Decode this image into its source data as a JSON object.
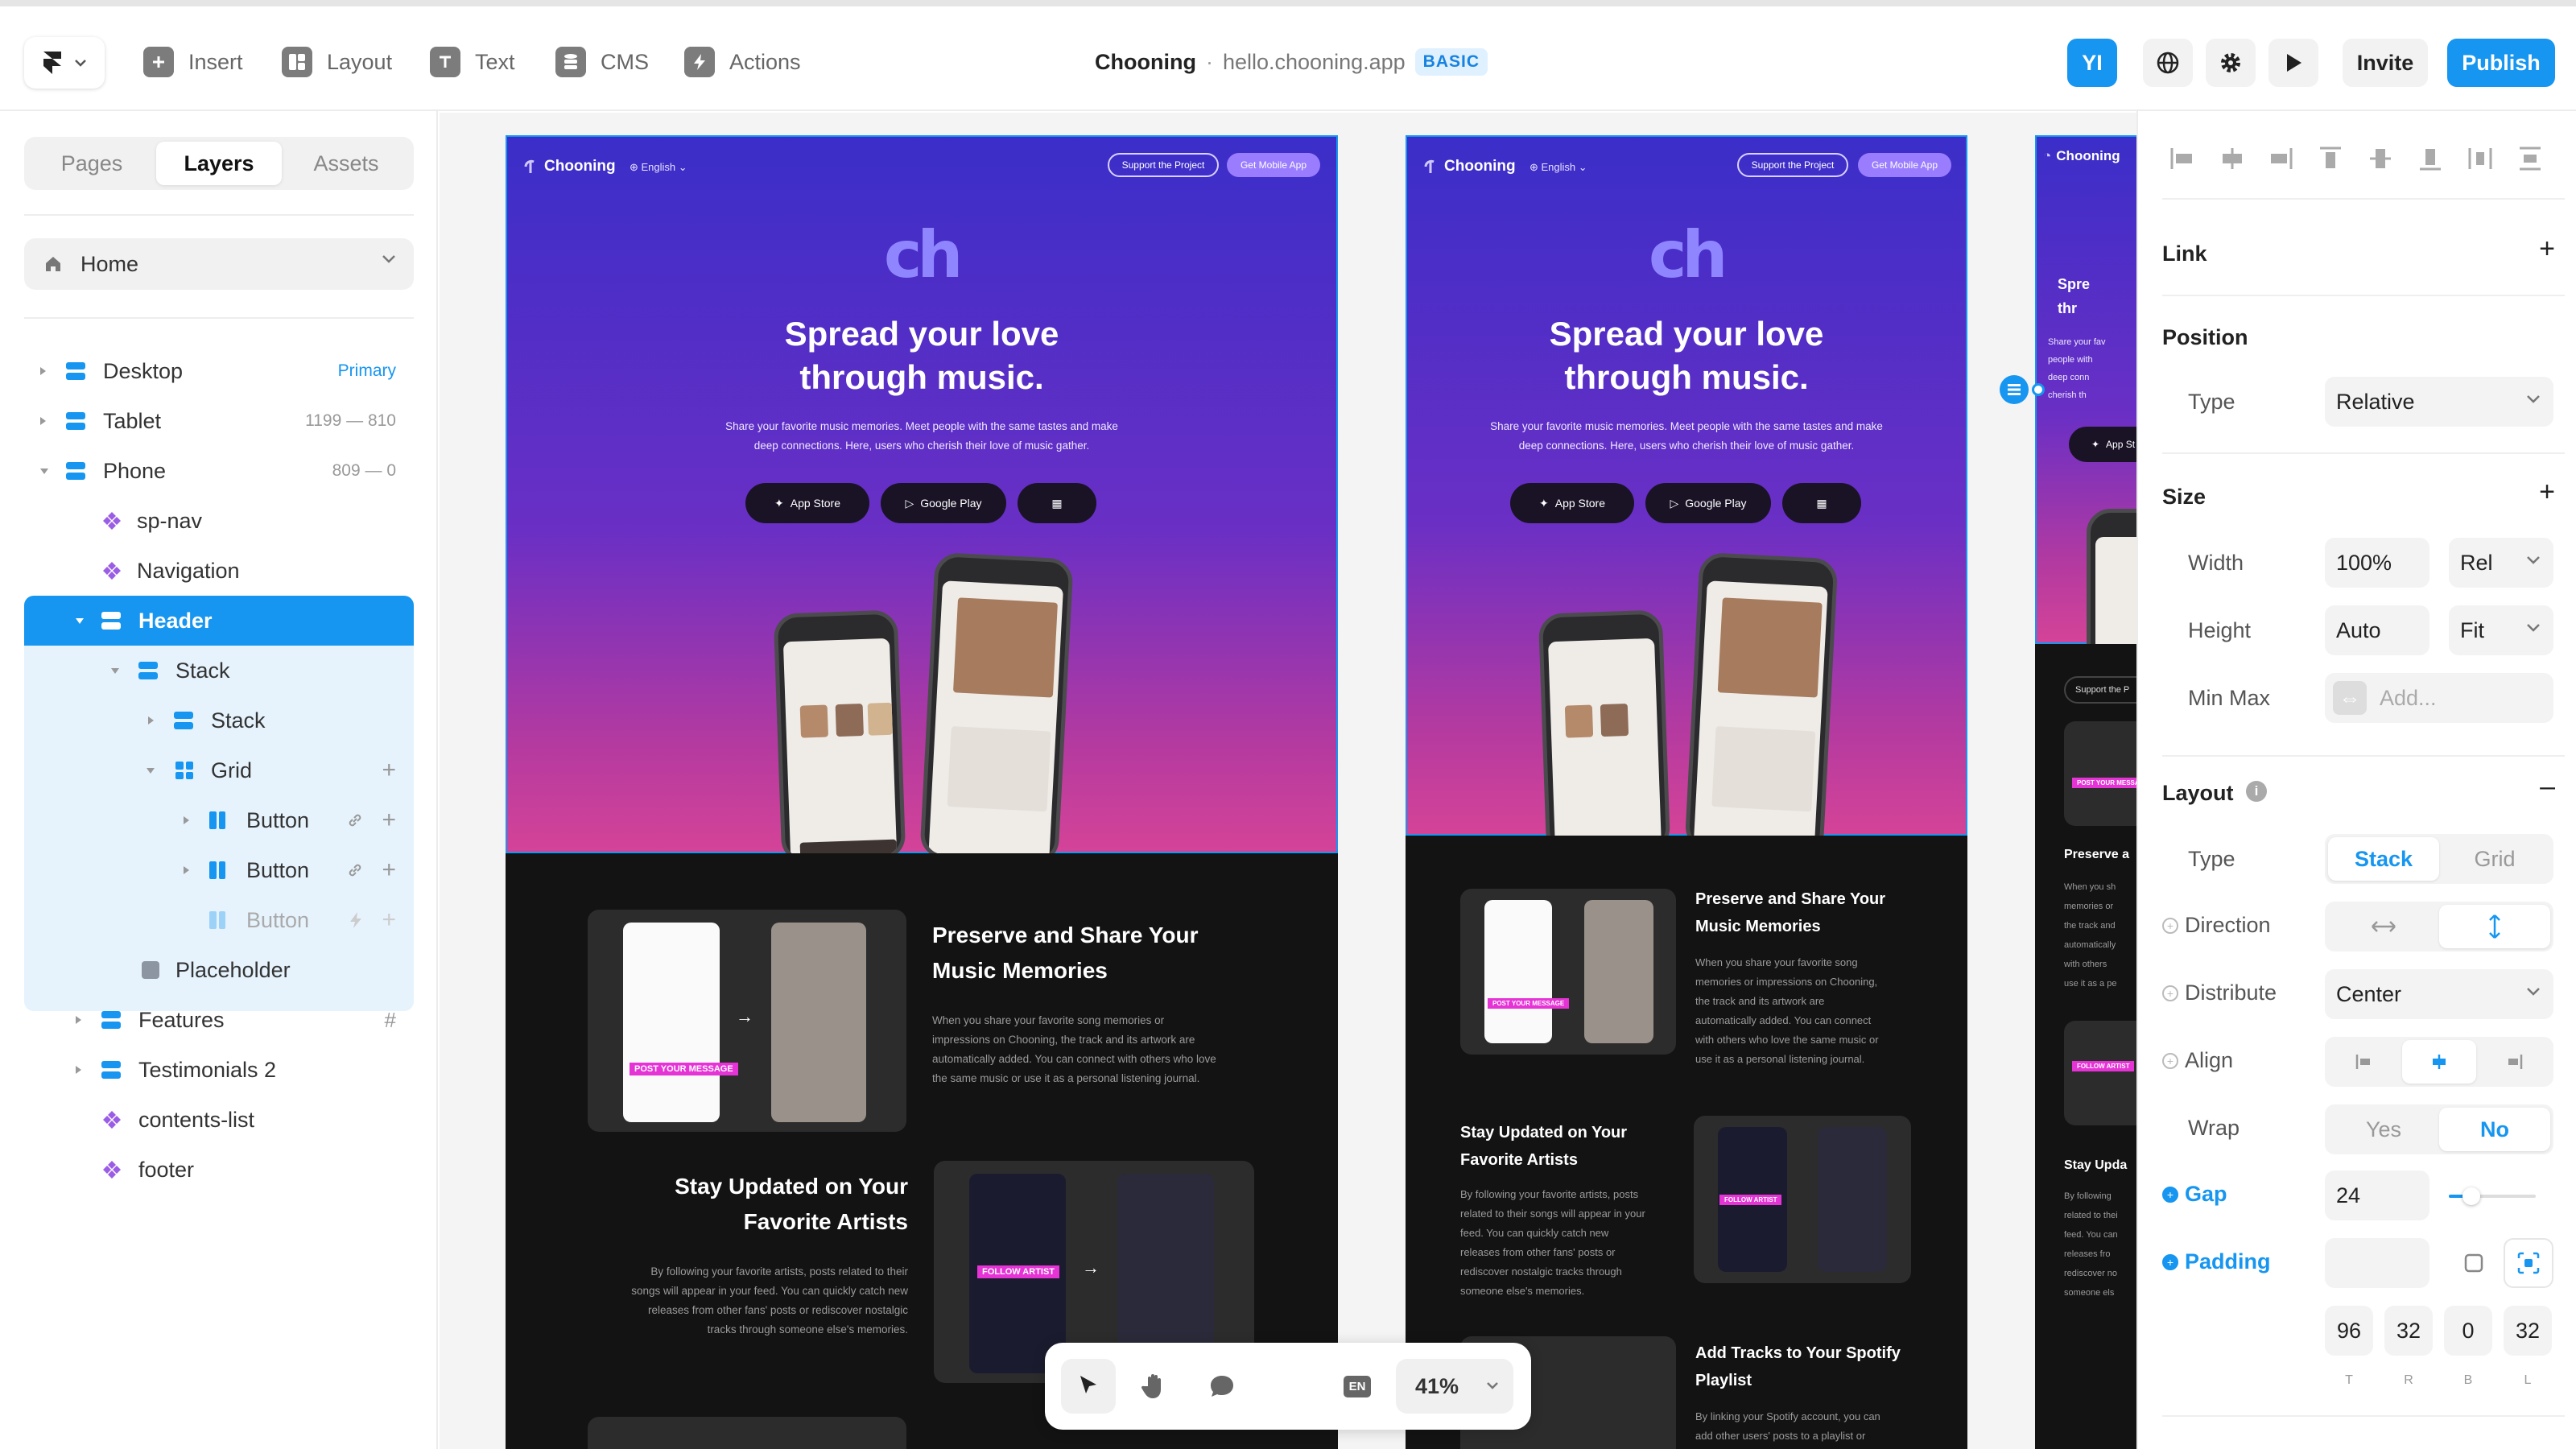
{
  "toolbar": {
    "insert": "Insert",
    "layout": "Layout",
    "text": "Text",
    "cms": "CMS",
    "actions": "Actions",
    "project_name": "Chooning",
    "separator": "·",
    "project_url": "hello.chooning.app",
    "plan_badge": "BASIC",
    "user_initials": "YI",
    "invite": "Invite",
    "publish": "Publish"
  },
  "left_panel": {
    "tabs": [
      "Pages",
      "Layers",
      "Assets"
    ],
    "active_tab": "Layers",
    "page_selector": "Home",
    "layers": [
      {
        "label": "Desktop",
        "meta": "Primary"
      },
      {
        "label": "Tablet",
        "meta": "1199 — 810"
      },
      {
        "label": "Phone",
        "meta": "809 — 0"
      },
      {
        "label": "sp-nav"
      },
      {
        "label": "Navigation"
      },
      {
        "label": "Header",
        "selected": true
      },
      {
        "label": "Stack"
      },
      {
        "label": "Stack"
      },
      {
        "label": "Grid"
      },
      {
        "label": "Button"
      },
      {
        "label": "Button"
      },
      {
        "label": "Button"
      },
      {
        "label": "Placeholder"
      },
      {
        "label": "Features",
        "meta": "#"
      },
      {
        "label": "Testimonials 2"
      },
      {
        "label": "contents-list"
      },
      {
        "label": "footer"
      }
    ]
  },
  "site": {
    "brand": "Chooning",
    "lang": "English",
    "support_btn": "Support the Project",
    "app_btn": "Get Mobile App",
    "hero_logo": "ch",
    "hero_title_1": "Spread your love",
    "hero_title_2": "through music.",
    "hero_sub_1": "Share your favorite music memories. Meet people with the same tastes and make",
    "hero_sub_2": "deep connections. Here, users who cherish their love of music gather.",
    "app_store": "App Store",
    "google_play": "Google Play",
    "post_tag": "POST YOUR MESSAGE",
    "follow_tag": "FOLLOW ARTIST",
    "feature1_title_1": "Preserve and Share Your",
    "feature1_title_2": "Music Memories",
    "feature1_body_1": "When you share your favorite song memories or",
    "feature1_body_2": "impressions on Chooning, the track and its artwork are",
    "feature1_body_3": "automatically added. You can connect with others who love",
    "feature1_body_4": "the same music or use it as a personal listening journal.",
    "feature2_title_1": "Stay Updated on Your",
    "feature2_title_2": "Favorite Artists",
    "feature2_body_1": "By following your favorite artists, posts related to their",
    "feature2_body_2": "songs will appear in your feed. You can quickly catch new",
    "feature2_body_3": "releases from other fans' posts or rediscover nostalgic",
    "feature2_body_4": "tracks through someone else's memories.",
    "tablet_f1_title_1": "Preserve and Share Your",
    "tablet_f1_title_2": "Music Memories",
    "tablet_f1_body": [
      "When you share your favorite song",
      "memories or impressions on Chooning,",
      "the track and its artwork are",
      "automatically added. You can connect",
      "with others who love the same music or",
      "use it as a personal listening journal."
    ],
    "tablet_f2_title_1": "Stay Updated on Your",
    "tablet_f2_title_2": "Favorite Artists",
    "tablet_f2_body": [
      "By following your favorite artists, posts",
      "related to their songs will appear in your",
      "feed. You can quickly catch new",
      "releases from other fans' posts or",
      "rediscover nostalgic tracks through",
      "someone else's memories."
    ],
    "tablet_f3_title_1": "Add Tracks to Your Spotify",
    "tablet_f3_title_2": "Playlist",
    "tablet_f3_body": [
      "By linking your Spotify account, you can",
      "add other users' posts to a playlist or"
    ],
    "phone_title": [
      "Spre",
      "thr"
    ],
    "phone_sub": [
      "Share your fav",
      "people with",
      "deep conn",
      "cherish th"
    ],
    "phone_store": "App St",
    "phone_support": "Support the P",
    "phone_f1": "Preserve a",
    "phone_f1_body": [
      "When you sh",
      "memories or",
      "the track and",
      "automatically",
      "with others",
      "use it as a pe"
    ],
    "phone_f2": "Stay Upda",
    "phone_f2_body": [
      "By following",
      "related to thei",
      "feed. You can",
      "releases fro",
      "rediscover no",
      "someone els"
    ]
  },
  "float_toolbar": {
    "lang": "EN",
    "zoom": "41%"
  },
  "right_panel": {
    "link": "Link",
    "position": "Position",
    "type_label": "Type",
    "position_type": "Relative",
    "size": "Size",
    "width_label": "Width",
    "width_value": "100%",
    "width_unit": "Rel",
    "height_label": "Height",
    "height_value": "Auto",
    "height_unit": "Fit",
    "minmax_label": "Min Max",
    "minmax_placeholder": "Add...",
    "layout": "Layout",
    "layout_type_stack": "Stack",
    "layout_type_grid": "Grid",
    "direction_label": "Direction",
    "distribute_label": "Distribute",
    "distribute_value": "Center",
    "align_label": "Align",
    "wrap_label": "Wrap",
    "wrap_yes": "Yes",
    "wrap_no": "No",
    "gap_label": "Gap",
    "gap_value": "24",
    "gap_slider": 0.2,
    "padding_label": "Padding",
    "padding_values": [
      "96",
      "32",
      "0",
      "32"
    ],
    "padding_sides": [
      "T",
      "R",
      "B",
      "L"
    ]
  },
  "colors": {
    "accent": "#1696f0",
    "hero_top": "#3b2ec8",
    "hero_bottom": "#d44397",
    "tag_pink": "#e533d6"
  }
}
